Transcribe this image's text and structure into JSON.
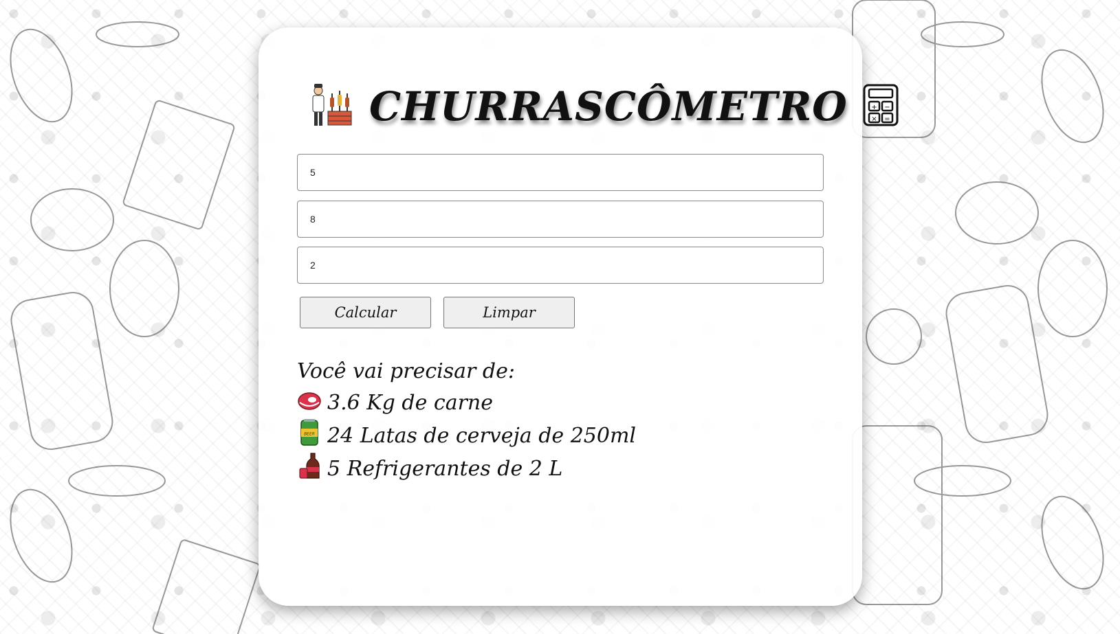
{
  "app": {
    "title": "CHURRASCÔMETRO",
    "icons": {
      "left": "chef-grill-icon",
      "right": "calculator-icon"
    }
  },
  "form": {
    "fields": [
      {
        "value": "5"
      },
      {
        "value": "8"
      },
      {
        "value": "2"
      }
    ],
    "buttons": {
      "calculate": "Calcular",
      "clear": "Limpar"
    }
  },
  "result": {
    "heading": "Você vai precisar de:",
    "items": [
      {
        "icon": "meat-icon",
        "text": "3.6 Kg de carne"
      },
      {
        "icon": "beer-can-icon",
        "text": "24 Latas de cerveja de 250ml"
      },
      {
        "icon": "soda-bottle-icon",
        "text": "5 Refrigerantes de 2 L"
      }
    ]
  },
  "colors": {
    "card_background": "#ffffff",
    "button_background": "#efefef",
    "text": "#111111"
  }
}
